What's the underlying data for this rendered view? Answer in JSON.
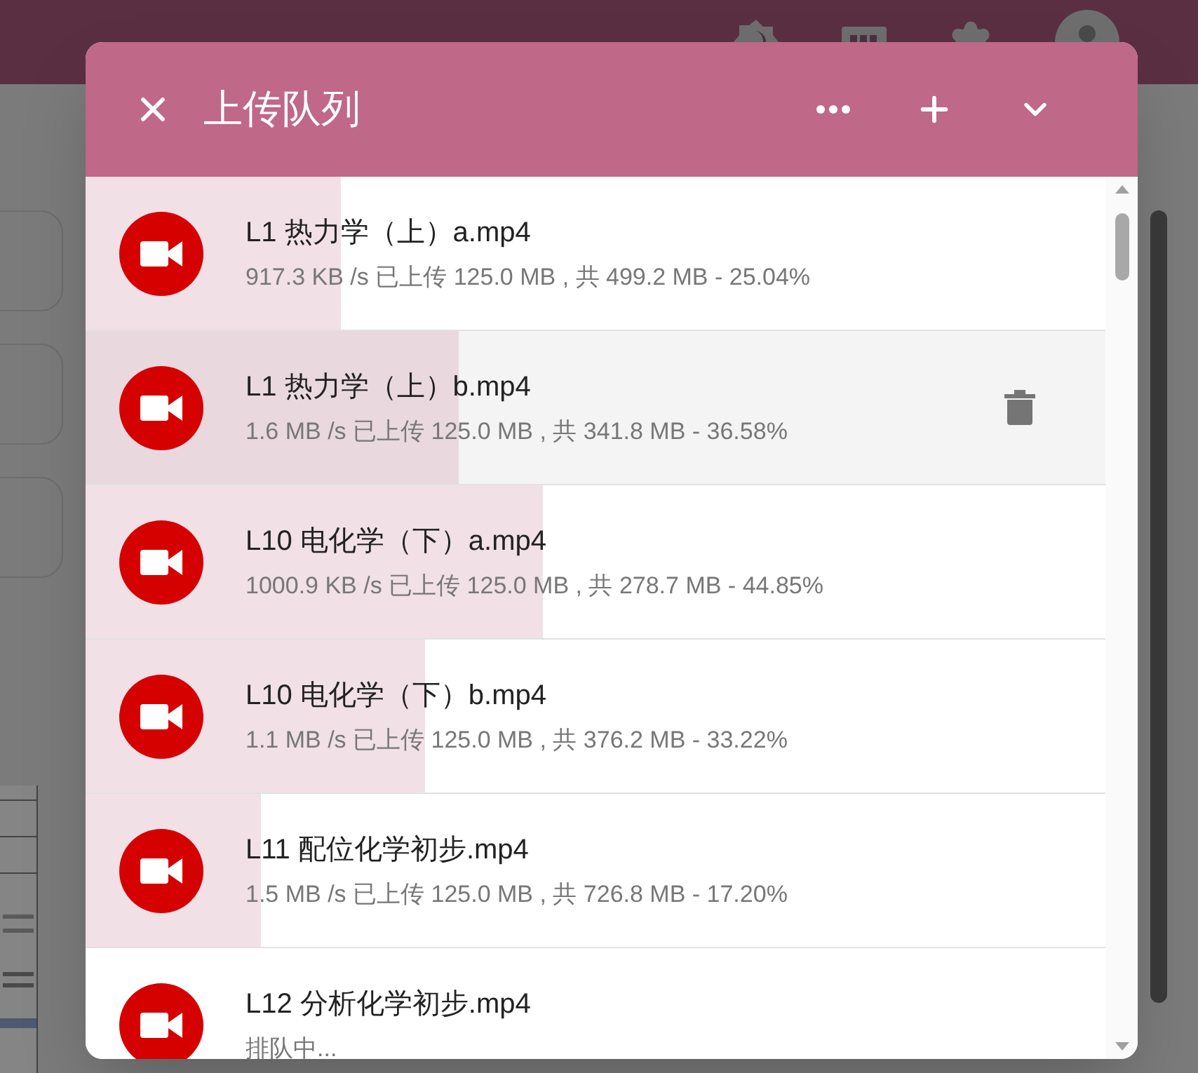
{
  "dialog": {
    "title": "上传队列",
    "items": [
      {
        "name": "L1 热力学（上）a.mp4",
        "status": "917.3 KB /s 已上传 125.0 MB , 共 499.2 MB - 25.04%",
        "level": 0.2504,
        "hovered": false
      },
      {
        "name": "L1 热力学（上）b.mp4",
        "status": "1.6 MB /s 已上传 125.0 MB , 共 341.8 MB - 36.58%",
        "level": 0.3658,
        "hovered": true
      },
      {
        "name": "L10 电化学（下）a.mp4",
        "status": "1000.9 KB /s 已上传 125.0 MB , 共 278.7 MB - 44.85%",
        "level": 0.4485,
        "hovered": false
      },
      {
        "name": "L10 电化学（下）b.mp4",
        "status": "1.1 MB /s 已上传 125.0 MB , 共 376.2 MB - 33.22%",
        "level": 0.3322,
        "hovered": false
      },
      {
        "name": "L11 配位化学初步.mp4",
        "status": "1.5 MB /s 已上传 125.0 MB , 共 726.8 MB - 17.20%",
        "level": 0.172,
        "hovered": false
      },
      {
        "name": "L12 分析化学初步.mp4",
        "status": "排队中...",
        "level": 0,
        "hovered": false
      }
    ]
  }
}
